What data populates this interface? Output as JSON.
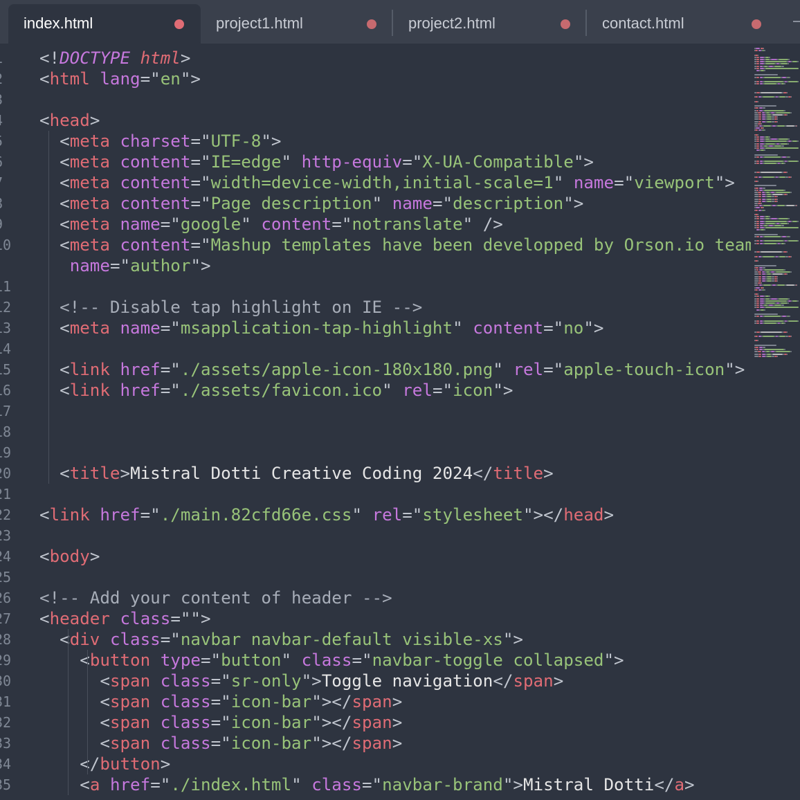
{
  "tabs": [
    {
      "label": "index.html",
      "active": true
    },
    {
      "label": "project1.html",
      "active": false
    },
    {
      "label": "project2.html",
      "active": false
    },
    {
      "label": "contact.html",
      "active": false
    }
  ],
  "colors": {
    "background": "#2e3440",
    "tab_bar": "#3a404c",
    "tag": "#e06c75",
    "attribute": "#c678dd",
    "string": "#98c379",
    "punctuation": "#c0c5ce",
    "comment": "#a7adb8",
    "text": "#e6e6e6",
    "modified_dot": "#e06c75"
  },
  "editor": {
    "lines": [
      {
        "num": "1",
        "tokens": [
          [
            "punct",
            "<!"
          ],
          [
            "doctype",
            "DOCTYPE"
          ],
          [
            "punct",
            " "
          ],
          [
            "doctypeval",
            "html"
          ],
          [
            "punct",
            ">"
          ]
        ]
      },
      {
        "num": "2",
        "tokens": [
          [
            "punct",
            "<"
          ],
          [
            "tag",
            "html"
          ],
          [
            "punct",
            " "
          ],
          [
            "attr",
            "lang"
          ],
          [
            "punct",
            "=\""
          ],
          [
            "str",
            "en"
          ],
          [
            "punct",
            "\">"
          ]
        ]
      },
      {
        "num": "3",
        "tokens": []
      },
      {
        "num": "4",
        "tokens": [
          [
            "punct",
            "<"
          ],
          [
            "tag",
            "head"
          ],
          [
            "punct",
            ">"
          ]
        ]
      },
      {
        "num": "5",
        "tokens": [
          [
            "punct",
            "  <"
          ],
          [
            "tag",
            "meta"
          ],
          [
            "punct",
            " "
          ],
          [
            "attr",
            "charset"
          ],
          [
            "punct",
            "=\""
          ],
          [
            "str",
            "UTF-8"
          ],
          [
            "punct",
            "\">"
          ]
        ]
      },
      {
        "num": "6",
        "tokens": [
          [
            "punct",
            "  <"
          ],
          [
            "tag",
            "meta"
          ],
          [
            "punct",
            " "
          ],
          [
            "attr",
            "content"
          ],
          [
            "punct",
            "=\""
          ],
          [
            "str",
            "IE=edge"
          ],
          [
            "punct",
            "\" "
          ],
          [
            "attr",
            "http-equiv"
          ],
          [
            "punct",
            "=\""
          ],
          [
            "str",
            "X-UA-Compatible"
          ],
          [
            "punct",
            "\">"
          ]
        ]
      },
      {
        "num": "7",
        "tokens": [
          [
            "punct",
            "  <"
          ],
          [
            "tag",
            "meta"
          ],
          [
            "punct",
            " "
          ],
          [
            "attr",
            "content"
          ],
          [
            "punct",
            "=\""
          ],
          [
            "str",
            "width=device-width,initial-scale=1"
          ],
          [
            "punct",
            "\" "
          ],
          [
            "attr",
            "name"
          ],
          [
            "punct",
            "=\""
          ],
          [
            "str",
            "viewport"
          ],
          [
            "punct",
            "\">"
          ]
        ]
      },
      {
        "num": "8",
        "tokens": [
          [
            "punct",
            "  <"
          ],
          [
            "tag",
            "meta"
          ],
          [
            "punct",
            " "
          ],
          [
            "attr",
            "content"
          ],
          [
            "punct",
            "=\""
          ],
          [
            "str",
            "Page description"
          ],
          [
            "punct",
            "\" "
          ],
          [
            "attr",
            "name"
          ],
          [
            "punct",
            "=\""
          ],
          [
            "str",
            "description"
          ],
          [
            "punct",
            "\">"
          ]
        ]
      },
      {
        "num": "9",
        "tokens": [
          [
            "punct",
            "  <"
          ],
          [
            "tag",
            "meta"
          ],
          [
            "punct",
            " "
          ],
          [
            "attr",
            "name"
          ],
          [
            "punct",
            "=\""
          ],
          [
            "str",
            "google"
          ],
          [
            "punct",
            "\" "
          ],
          [
            "attr",
            "content"
          ],
          [
            "punct",
            "=\""
          ],
          [
            "str",
            "notranslate"
          ],
          [
            "punct",
            "\" />"
          ]
        ]
      },
      {
        "num": "10",
        "tokens": [
          [
            "punct",
            "  <"
          ],
          [
            "tag",
            "meta"
          ],
          [
            "punct",
            " "
          ],
          [
            "attr",
            "content"
          ],
          [
            "punct",
            "=\""
          ],
          [
            "str",
            "Mashup templates have been developped by Orson.io team"
          ],
          [
            "punct",
            "\""
          ]
        ]
      },
      {
        "num": "",
        "tokens": [
          [
            "punct",
            "   "
          ],
          [
            "attr",
            "name"
          ],
          [
            "punct",
            "=\""
          ],
          [
            "str",
            "author"
          ],
          [
            "punct",
            "\">"
          ]
        ]
      },
      {
        "num": "11",
        "tokens": []
      },
      {
        "num": "12",
        "tokens": [
          [
            "comment",
            "  <!-- Disable tap highlight on IE -->"
          ]
        ]
      },
      {
        "num": "13",
        "tokens": [
          [
            "punct",
            "  <"
          ],
          [
            "tag",
            "meta"
          ],
          [
            "punct",
            " "
          ],
          [
            "attr",
            "name"
          ],
          [
            "punct",
            "=\""
          ],
          [
            "str",
            "msapplication-tap-highlight"
          ],
          [
            "punct",
            "\" "
          ],
          [
            "attr",
            "content"
          ],
          [
            "punct",
            "=\""
          ],
          [
            "str",
            "no"
          ],
          [
            "punct",
            "\">"
          ]
        ]
      },
      {
        "num": "14",
        "tokens": []
      },
      {
        "num": "15",
        "tokens": [
          [
            "punct",
            "  <"
          ],
          [
            "tag",
            "link"
          ],
          [
            "punct",
            " "
          ],
          [
            "attr",
            "href"
          ],
          [
            "punct",
            "=\""
          ],
          [
            "str",
            "./assets/apple-icon-180x180.png"
          ],
          [
            "punct",
            "\" "
          ],
          [
            "attr",
            "rel"
          ],
          [
            "punct",
            "=\""
          ],
          [
            "str",
            "apple-touch-icon"
          ],
          [
            "punct",
            "\">"
          ]
        ]
      },
      {
        "num": "16",
        "tokens": [
          [
            "punct",
            "  <"
          ],
          [
            "tag",
            "link"
          ],
          [
            "punct",
            " "
          ],
          [
            "attr",
            "href"
          ],
          [
            "punct",
            "=\""
          ],
          [
            "str",
            "./assets/favicon.ico"
          ],
          [
            "punct",
            "\" "
          ],
          [
            "attr",
            "rel"
          ],
          [
            "punct",
            "=\""
          ],
          [
            "str",
            "icon"
          ],
          [
            "punct",
            "\">"
          ]
        ]
      },
      {
        "num": "17",
        "tokens": []
      },
      {
        "num": "18",
        "tokens": []
      },
      {
        "num": "19",
        "tokens": []
      },
      {
        "num": "20",
        "tokens": [
          [
            "punct",
            "  <"
          ],
          [
            "tag",
            "title"
          ],
          [
            "punct",
            ">"
          ],
          [
            "text",
            "Mistral Dotti Creative Coding 2024"
          ],
          [
            "punct",
            "</"
          ],
          [
            "tag",
            "title"
          ],
          [
            "punct",
            ">"
          ]
        ]
      },
      {
        "num": "21",
        "tokens": []
      },
      {
        "num": "22",
        "tokens": [
          [
            "punct",
            "<"
          ],
          [
            "tag",
            "link"
          ],
          [
            "punct",
            " "
          ],
          [
            "attr",
            "href"
          ],
          [
            "punct",
            "=\""
          ],
          [
            "str",
            "./main.82cfd66e.css"
          ],
          [
            "punct",
            "\" "
          ],
          [
            "attr",
            "rel"
          ],
          [
            "punct",
            "=\""
          ],
          [
            "str",
            "stylesheet"
          ],
          [
            "punct",
            "\"></"
          ],
          [
            "tag",
            "head"
          ],
          [
            "punct",
            ">"
          ]
        ]
      },
      {
        "num": "23",
        "tokens": []
      },
      {
        "num": "24",
        "tokens": [
          [
            "punct",
            "<"
          ],
          [
            "tag",
            "body"
          ],
          [
            "punct",
            ">"
          ]
        ]
      },
      {
        "num": "25",
        "tokens": []
      },
      {
        "num": "26",
        "tokens": [
          [
            "comment",
            "<!-- Add your content of header -->"
          ]
        ]
      },
      {
        "num": "27",
        "tokens": [
          [
            "punct",
            "<"
          ],
          [
            "tag",
            "header"
          ],
          [
            "punct",
            " "
          ],
          [
            "attr",
            "class"
          ],
          [
            "punct",
            "=\"\">"
          ]
        ]
      },
      {
        "num": "28",
        "tokens": [
          [
            "punct",
            "  <"
          ],
          [
            "tag",
            "div"
          ],
          [
            "punct",
            " "
          ],
          [
            "attr",
            "class"
          ],
          [
            "punct",
            "=\""
          ],
          [
            "str",
            "navbar navbar-default visible-xs"
          ],
          [
            "punct",
            "\">"
          ]
        ]
      },
      {
        "num": "29",
        "tokens": [
          [
            "punct",
            "    <"
          ],
          [
            "tag",
            "button"
          ],
          [
            "punct",
            " "
          ],
          [
            "attr",
            "type"
          ],
          [
            "punct",
            "=\""
          ],
          [
            "str",
            "button"
          ],
          [
            "punct",
            "\" "
          ],
          [
            "attr",
            "class"
          ],
          [
            "punct",
            "=\""
          ],
          [
            "str",
            "navbar-toggle collapsed"
          ],
          [
            "punct",
            "\">"
          ]
        ]
      },
      {
        "num": "30",
        "tokens": [
          [
            "punct",
            "      <"
          ],
          [
            "tag",
            "span"
          ],
          [
            "punct",
            " "
          ],
          [
            "attr",
            "class"
          ],
          [
            "punct",
            "=\""
          ],
          [
            "str",
            "sr-only"
          ],
          [
            "punct",
            "\">"
          ],
          [
            "text",
            "Toggle navigation"
          ],
          [
            "punct",
            "</"
          ],
          [
            "tag",
            "span"
          ],
          [
            "punct",
            ">"
          ]
        ]
      },
      {
        "num": "31",
        "tokens": [
          [
            "punct",
            "      <"
          ],
          [
            "tag",
            "span"
          ],
          [
            "punct",
            " "
          ],
          [
            "attr",
            "class"
          ],
          [
            "punct",
            "=\""
          ],
          [
            "str",
            "icon-bar"
          ],
          [
            "punct",
            "\"></"
          ],
          [
            "tag",
            "span"
          ],
          [
            "punct",
            ">"
          ]
        ]
      },
      {
        "num": "32",
        "tokens": [
          [
            "punct",
            "      <"
          ],
          [
            "tag",
            "span"
          ],
          [
            "punct",
            " "
          ],
          [
            "attr",
            "class"
          ],
          [
            "punct",
            "=\""
          ],
          [
            "str",
            "icon-bar"
          ],
          [
            "punct",
            "\"></"
          ],
          [
            "tag",
            "span"
          ],
          [
            "punct",
            ">"
          ]
        ]
      },
      {
        "num": "33",
        "tokens": [
          [
            "punct",
            "      <"
          ],
          [
            "tag",
            "span"
          ],
          [
            "punct",
            " "
          ],
          [
            "attr",
            "class"
          ],
          [
            "punct",
            "=\""
          ],
          [
            "str",
            "icon-bar"
          ],
          [
            "punct",
            "\"></"
          ],
          [
            "tag",
            "span"
          ],
          [
            "punct",
            ">"
          ]
        ]
      },
      {
        "num": "34",
        "tokens": [
          [
            "punct",
            "    </"
          ],
          [
            "tag",
            "button"
          ],
          [
            "punct",
            ">"
          ]
        ]
      },
      {
        "num": "35",
        "tokens": [
          [
            "punct",
            "    <"
          ],
          [
            "tag",
            "a"
          ],
          [
            "punct",
            " "
          ],
          [
            "attr",
            "href"
          ],
          [
            "punct",
            "=\""
          ],
          [
            "str",
            "./index.html"
          ],
          [
            "punct",
            "\" "
          ],
          [
            "attr",
            "class"
          ],
          [
            "punct",
            "=\""
          ],
          [
            "str",
            "navbar-brand"
          ],
          [
            "punct",
            "\">"
          ],
          [
            "text",
            "Mistral Dotti"
          ],
          [
            "punct",
            "</"
          ],
          [
            "tag",
            "a"
          ],
          [
            "punct",
            ">"
          ]
        ]
      }
    ]
  }
}
